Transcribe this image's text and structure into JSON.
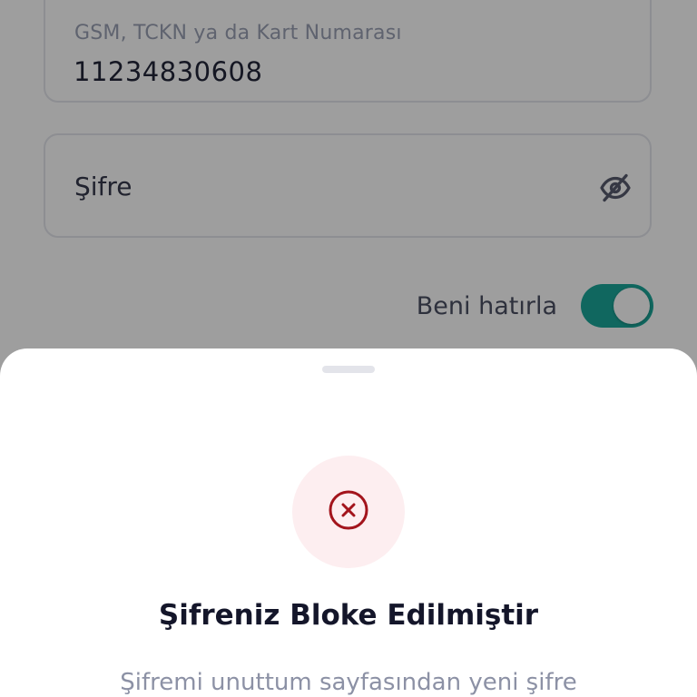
{
  "login": {
    "gsm_field": {
      "label": "GSM, TCKN ya da Kart Numarası",
      "value": "11234830608"
    },
    "password_field": {
      "placeholder": "Şifre",
      "toggle_icon": "eye-off-icon"
    },
    "remember_me": {
      "label": "Beni hatırla",
      "enabled": true
    }
  },
  "sheet": {
    "status_icon": "error-circle-x-icon",
    "title": "Şifreniz Bloke Edilmiştir",
    "description": "Şifremi unuttum sayfasından yeni şifre"
  },
  "colors": {
    "accent": "#1ba79a",
    "error": "#a3141c",
    "error_bg": "#fdeef0"
  }
}
